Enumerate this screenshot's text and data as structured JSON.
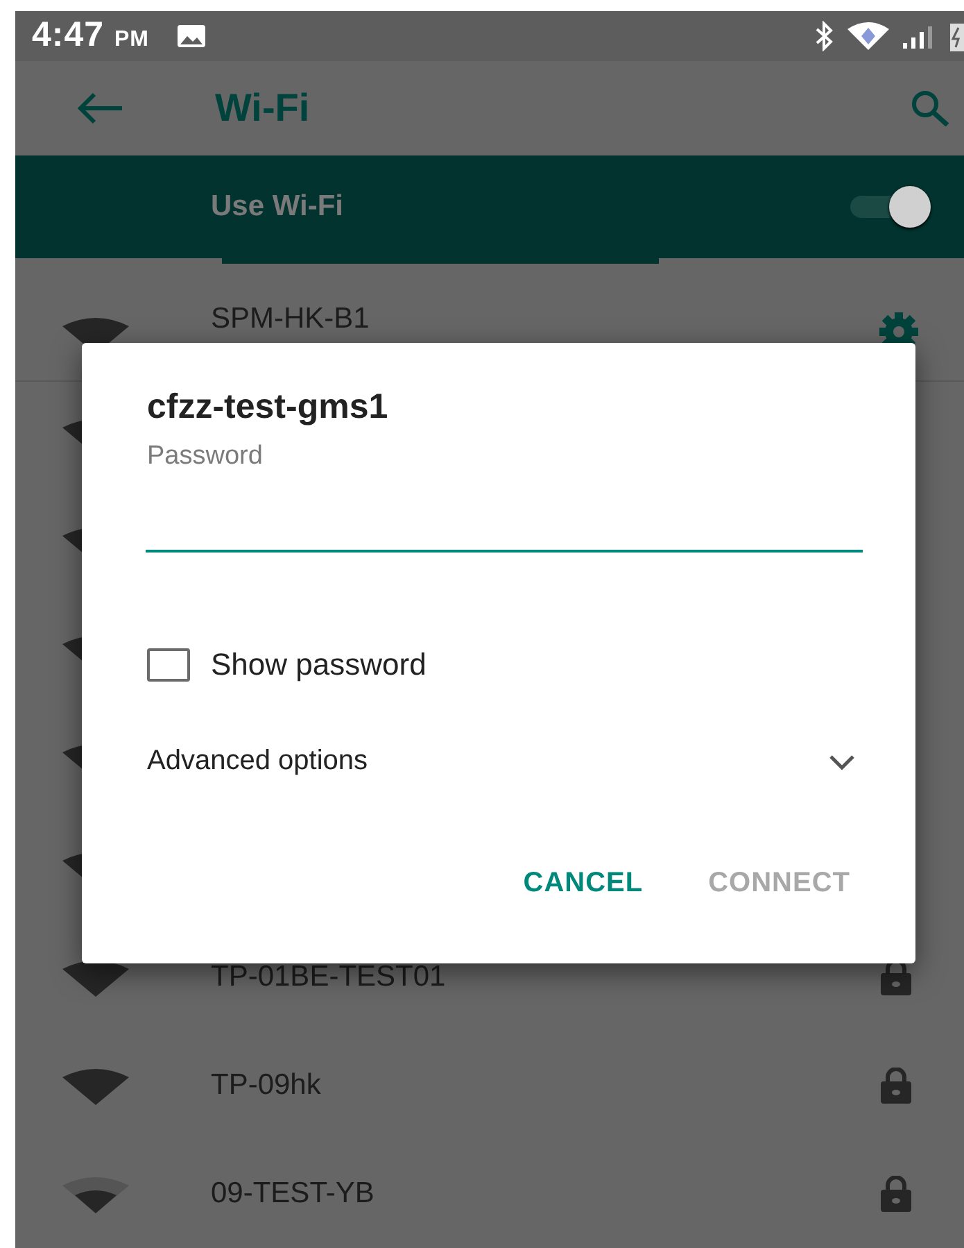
{
  "status_bar": {
    "time": "4:47",
    "meridiem": "PM"
  },
  "app_bar": {
    "title": "Wi-Fi"
  },
  "master_switch": {
    "label": "Use Wi-Fi",
    "on": true,
    "scanning": true
  },
  "networks": [
    {
      "kind": "saved",
      "ssid": "SPM-HK-B1",
      "weak_signal": false
    },
    {
      "kind": "covered",
      "weak_signal": false
    },
    {
      "kind": "covered",
      "weak_signal": false
    },
    {
      "kind": "covered",
      "weak_signal": false
    },
    {
      "kind": "covered",
      "weak_signal": false
    },
    {
      "kind": "covered",
      "weak_signal": false
    },
    {
      "kind": "locked",
      "ssid": "TP-01BE-TEST01",
      "weak_signal": false
    },
    {
      "kind": "locked",
      "ssid": "TP-09hk",
      "weak_signal": false
    },
    {
      "kind": "locked",
      "ssid": "09-TEST-YB",
      "weak_signal": true
    }
  ],
  "dialog": {
    "title": "cfzz-test-gms1",
    "password": {
      "label": "Password"
    },
    "show_password": {
      "label": "Show password",
      "checked": false
    },
    "advanced": {
      "label": "Advanced options",
      "expanded": false
    },
    "buttons": [
      {
        "label": "CANCEL",
        "disabled": false
      },
      {
        "label": "CONNECT",
        "disabled": true
      }
    ]
  }
}
